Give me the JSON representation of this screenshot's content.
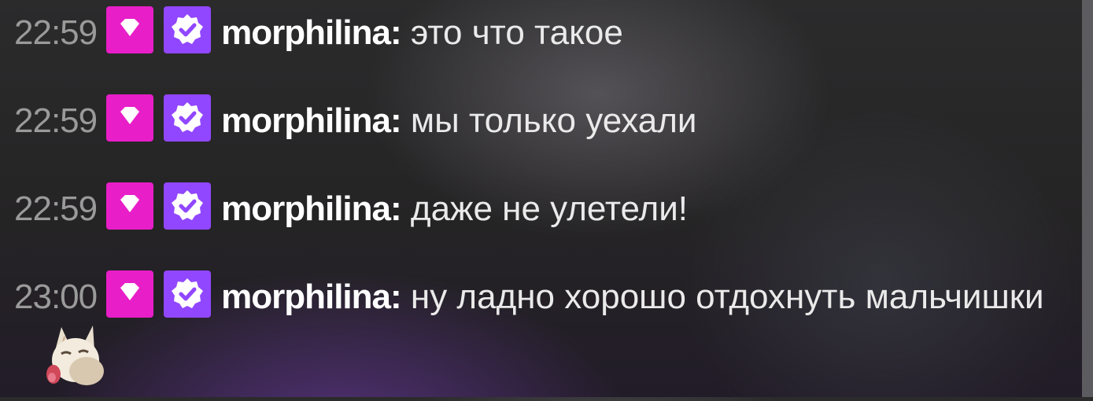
{
  "chat": {
    "messages": [
      {
        "time": "22:59",
        "username": "morphilina",
        "separator": ":",
        "text": "это что такое",
        "badges": [
          "gift-diamond-badge",
          "verified-badge"
        ]
      },
      {
        "time": "22:59",
        "username": "morphilina",
        "separator": ":",
        "text": "мы только уехали",
        "badges": [
          "gift-diamond-badge",
          "verified-badge"
        ]
      },
      {
        "time": "22:59",
        "username": "morphilina",
        "separator": ":",
        "text": "даже не улетели!",
        "badges": [
          "gift-diamond-badge",
          "verified-badge"
        ]
      },
      {
        "time": "23:00",
        "username": "morphilina",
        "separator": ":",
        "text": "ну ладно хорошо отдохнуть мальчишки",
        "badges": [
          "gift-diamond-badge",
          "verified-badge"
        ],
        "emote": "white-fox-licking-emote"
      }
    ]
  },
  "colors": {
    "gift_badge": "#e81ec8",
    "verified_badge": "#9147ff",
    "timestamp": "#9a9a9a",
    "username": "#ffffff",
    "message_text": "#eaeaea"
  }
}
